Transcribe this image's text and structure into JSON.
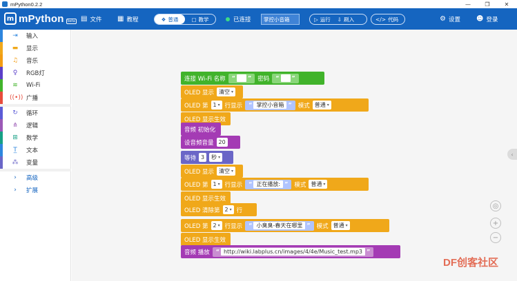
{
  "window": {
    "title": "mPython0.2.2",
    "controls": [
      "—",
      "❐",
      "✕"
    ]
  },
  "toolbar": {
    "logo": "mPython",
    "logo_badge": "beta",
    "file": "文件",
    "tutorial": "教程",
    "mode_normal": "普通",
    "mode_teach": "教学",
    "status": "已连接",
    "device": "掌控小音箱",
    "run": "运行",
    "flash": "刷入",
    "code": "代码",
    "settings": "设置",
    "login": "登录"
  },
  "sidebar": {
    "items": [
      {
        "label": "输入",
        "icon": "input-icon",
        "color": "#2e86de"
      },
      {
        "label": "显示",
        "icon": "display-icon",
        "color": "#f0a81a"
      },
      {
        "label": "音乐",
        "icon": "music-icon",
        "color": "#f39c12"
      },
      {
        "label": "RGB灯",
        "icon": "bulb-icon",
        "color": "#5b3fc9"
      },
      {
        "label": "Wi-Fi",
        "icon": "wifi-icon",
        "color": "#41b32b"
      },
      {
        "label": "广播",
        "icon": "broadcast-icon",
        "color": "#e74c3c"
      },
      {
        "label": "循环",
        "icon": "loop-icon",
        "color": "#5b5bd6"
      },
      {
        "label": "逻辑",
        "icon": "logic-icon",
        "color": "#9b59b6"
      },
      {
        "label": "数学",
        "icon": "math-icon",
        "color": "#16a085"
      },
      {
        "label": "文本",
        "icon": "text-icon",
        "color": "#2e86de"
      },
      {
        "label": "变量",
        "icon": "variable-icon",
        "color": "#6a66c7"
      },
      {
        "label": "高级",
        "icon": "chevron-right-icon",
        "color": "#ffffff"
      },
      {
        "label": "扩展",
        "icon": "chevron-right-icon",
        "color": "#ffffff"
      }
    ]
  },
  "blocks": {
    "wifi_connect": {
      "label": "连接 Wi-Fi 名称",
      "pwd": "密码",
      "name_value": "",
      "pwd_value": ""
    },
    "oled_show": "OLED 显示",
    "clear": "清空",
    "oled_line": "OLED 第",
    "line_show": "行显示",
    "mode": "模式",
    "normal": "普通",
    "oled_effect": "OLED 显示生效",
    "audio_init": "音频 初始化",
    "set_volume": "设音频音量",
    "volume": "20",
    "wait": "等待",
    "wait_value": "3",
    "seconds": "秒",
    "oled_clear_line": "OLED 清除第",
    "line_suffix": "行",
    "audio_play": "音频 播放",
    "line1": "1",
    "line2": "2",
    "text1": "掌控小音箱",
    "text2": "正在播放:",
    "text3": "小臭臭-春天在哪里",
    "url": "http://wiki.labplus.cn/images/4/4e/Music_test.mp3"
  },
  "watermark": "DF创客社区"
}
